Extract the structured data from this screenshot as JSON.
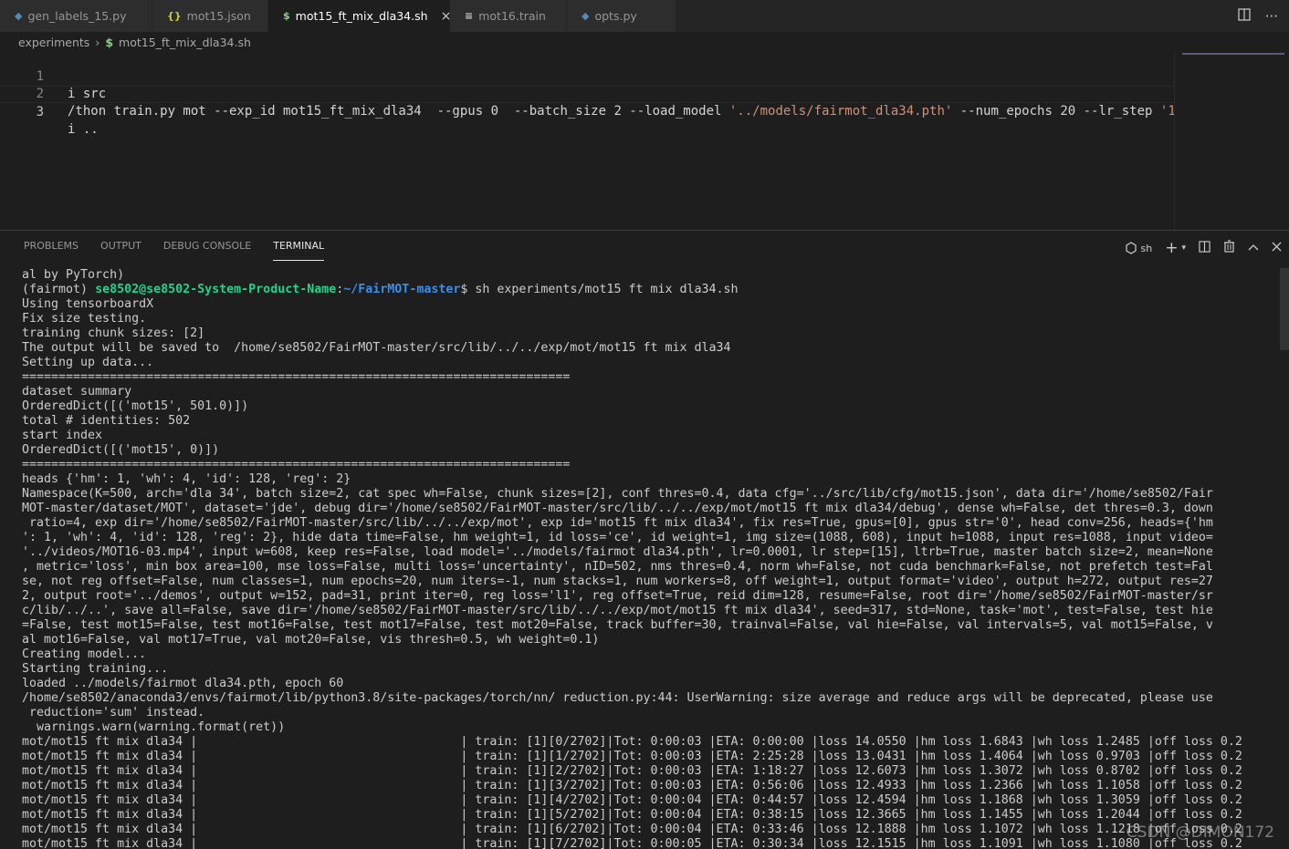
{
  "tabs": [
    {
      "icon": "python-icon",
      "glyph": "◆",
      "label": "gen_labels_15.py",
      "color": "#4b8bbe"
    },
    {
      "icon": "json-icon",
      "glyph": "{}",
      "label": "mot15.json",
      "color": "#cbcb41"
    },
    {
      "icon": "shell-icon",
      "glyph": "$",
      "label": "mot15_ft_mix_dla34.sh",
      "color": "#89d185"
    },
    {
      "icon": "text-file-icon",
      "glyph": "≡",
      "label": "mot16.train",
      "color": "#cccccc"
    },
    {
      "icon": "python-icon",
      "glyph": "◆",
      "label": "opts.py",
      "color": "#4b8bbe"
    }
  ],
  "tab_close": "×",
  "breadcrumb": {
    "folder": "experiments",
    "sep": "›",
    "file_icon": "$",
    "file": "mot15_ft_mix_dla34.sh"
  },
  "editor": {
    "lines": [
      {
        "num": "1",
        "text": "i src"
      },
      {
        "num": "2",
        "text_plain": "/thon train.py mot --exp_id mot15_ft_mix_dla34  --gpus 0  --batch_size 2 --load_model ",
        "text_str": "'../models/fairmot_dla34.pth'",
        "text_tail": " --num_epochs 20 --lr_step ",
        "text_str2": "'1"
      },
      {
        "num": "3",
        "text": "i .."
      }
    ]
  },
  "panel": {
    "tabs": [
      "PROBLEMS",
      "OUTPUT",
      "DEBUG CONSOLE",
      "TERMINAL"
    ],
    "shell_label": "sh"
  },
  "terminal": {
    "line0": "al by PyTorch)",
    "prompt_env": "(fairmot) ",
    "prompt_user": "se8502@se8502-System-Product-Name",
    "prompt_colon": ":",
    "prompt_path": "~/FairMOT-master",
    "prompt_cmd": "$ sh experiments/mot15 ft mix dla34.sh",
    "lines": [
      "Using tensorboardX",
      "Fix size testing.",
      "training chunk sizes: [2]",
      "The output will be saved to  /home/se8502/FairMOT-master/src/lib/../../exp/mot/mot15 ft mix dla34",
      "Setting up data...",
      "===========================================================================",
      "dataset summary",
      "OrderedDict([('mot15', 501.0)])",
      "total # identities: 502",
      "start index",
      "OrderedDict([('mot15', 0)])",
      "===========================================================================",
      "heads {'hm': 1, 'wh': 4, 'id': 128, 'reg': 2}",
      "Namespace(K=500, arch='dla 34', batch size=2, cat spec wh=False, chunk sizes=[2], conf thres=0.4, data cfg='../src/lib/cfg/mot15.json', data dir='/home/se8502/Fair",
      "MOT-master/dataset/MOT', dataset='jde', debug dir='/home/se8502/FairMOT-master/src/lib/../../exp/mot/mot15 ft mix dla34/debug', dense wh=False, det thres=0.3, down",
      " ratio=4, exp dir='/home/se8502/FairMOT-master/src/lib/../../exp/mot', exp id='mot15 ft mix dla34', fix res=True, gpus=[0], gpus str='0', head conv=256, heads={'hm",
      "': 1, 'wh': 4, 'id': 128, 'reg': 2}, hide data time=False, hm weight=1, id loss='ce', id weight=1, img size=(1088, 608), input h=1088, input res=1088, input video=",
      "'../videos/MOT16-03.mp4', input w=608, keep res=False, load model='../models/fairmot dla34.pth', lr=0.0001, lr step=[15], ltrb=True, master batch size=2, mean=None",
      ", metric='loss', min box area=100, mse loss=False, multi loss='uncertainty', nID=502, nms thres=0.4, norm wh=False, not cuda benchmark=False, not prefetch test=Fal",
      "se, not reg offset=False, num classes=1, num epochs=20, num iters=-1, num stacks=1, num workers=8, off weight=1, output format='video', output h=272, output res=27",
      "2, output root='../demos', output w=152, pad=31, print iter=0, reg loss='l1', reg offset=True, reid dim=128, resume=False, root dir='/home/se8502/FairMOT-master/sr",
      "c/lib/../..', save all=False, save dir='/home/se8502/FairMOT-master/src/lib/../../exp/mot/mot15 ft mix dla34', seed=317, std=None, task='mot', test=False, test hie",
      "=False, test mot15=False, test mot16=False, test mot17=False, test mot20=False, track buffer=30, trainval=False, val hie=False, val intervals=5, val mot15=False, v",
      "al mot16=False, val mot17=True, val mot20=False, vis thresh=0.5, wh weight=0.1)",
      "Creating model...",
      "Starting training...",
      "loaded ../models/fairmot dla34.pth, epoch 60",
      "/home/se8502/anaconda3/envs/fairmot/lib/python3.8/site-packages/torch/nn/ reduction.py:44: UserWarning: size average and reduce args will be deprecated, please use",
      " reduction='sum' instead.",
      "  warnings.warn(warning.format(ret))",
      "mot/mot15 ft mix dla34 |                                    | train: [1][0/2702]|Tot: 0:00:03 |ETA: 0:00:00 |loss 14.0550 |hm loss 1.6843 |wh loss 1.2485 |off loss 0.2",
      "mot/mot15 ft mix dla34 |                                    | train: [1][1/2702]|Tot: 0:00:03 |ETA: 2:25:28 |loss 13.0431 |hm loss 1.4064 |wh loss 0.9703 |off loss 0.2",
      "mot/mot15 ft mix dla34 |                                    | train: [1][2/2702]|Tot: 0:00:03 |ETA: 1:18:27 |loss 12.6073 |hm loss 1.3072 |wh loss 0.8702 |off loss 0.2",
      "mot/mot15 ft mix dla34 |                                    | train: [1][3/2702]|Tot: 0:00:03 |ETA: 0:56:06 |loss 12.4933 |hm loss 1.2366 |wh loss 1.1058 |off loss 0.2",
      "mot/mot15 ft mix dla34 |                                    | train: [1][4/2702]|Tot: 0:00:04 |ETA: 0:44:57 |loss 12.4594 |hm loss 1.1868 |wh loss 1.3059 |off loss 0.2",
      "mot/mot15 ft mix dla34 |                                    | train: [1][5/2702]|Tot: 0:00:04 |ETA: 0:38:15 |loss 12.3665 |hm loss 1.1455 |wh loss 1.2044 |off loss 0.2",
      "mot/mot15 ft mix dla34 |                                    | train: [1][6/2702]|Tot: 0:00:04 |ETA: 0:33:46 |loss 12.1888 |hm loss 1.1072 |wh loss 1.1218 |off loss 0.2",
      "mot/mot15 ft mix dla34 |                                    | train: [1][7/2702]|Tot: 0:00:05 |ETA: 0:30:34 |loss 12.1515 |hm loss 1.1091 |wh loss 1.1080 |off loss 0.2"
    ]
  },
  "watermark": "CSDN @DIMON172"
}
